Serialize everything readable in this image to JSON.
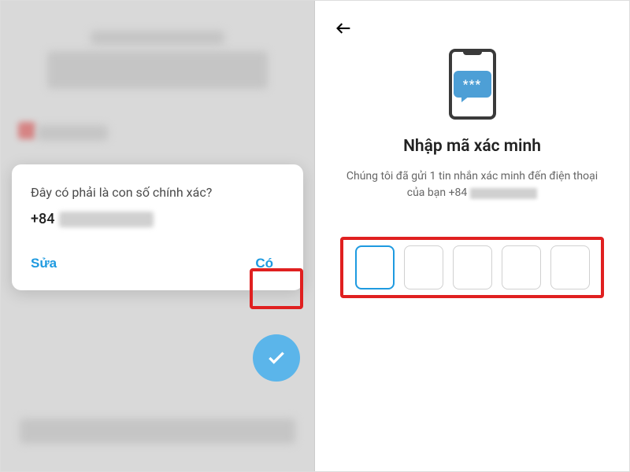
{
  "left": {
    "dialog": {
      "question": "Đây có phải là con số chính xác?",
      "phone_prefix": "+84",
      "edit_label": "Sửa",
      "yes_label": "Có"
    }
  },
  "right": {
    "title": "Nhập mã xác minh",
    "description_before": "Chúng tôi đã gửi 1 tin nhắn xác minh đến điện thoại của bạn ",
    "phone_prefix": "+84",
    "sms_stars": "***",
    "code_length": 5
  }
}
